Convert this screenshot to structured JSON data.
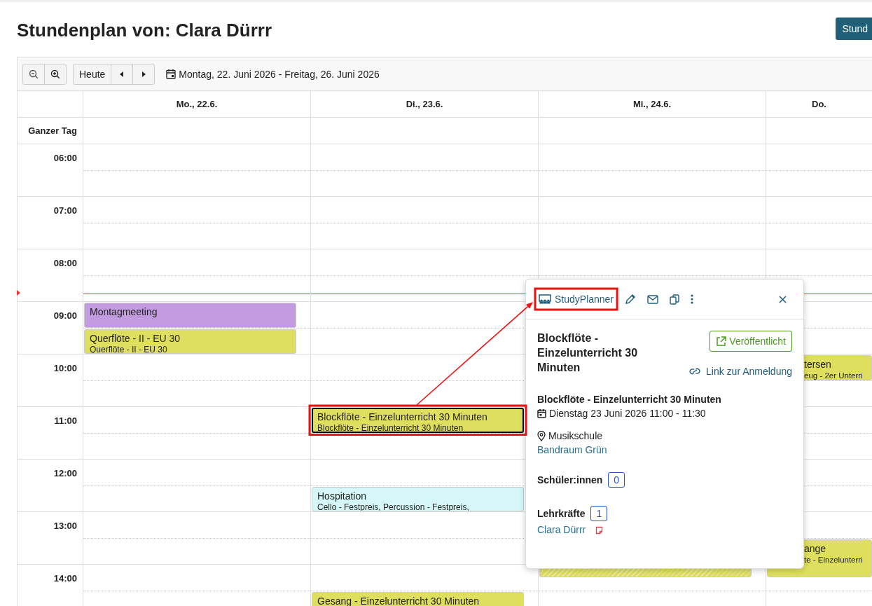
{
  "page": {
    "title": "Stundenplan von: Clara Dürrr",
    "action_button": "Stund"
  },
  "toolbar": {
    "today": "Heute",
    "date_range": "Montag, 22. Juni 2026 - Freitag, 26. Juni 2026"
  },
  "calendar": {
    "all_day_label": "Ganzer Tag",
    "days": [
      {
        "label": "Mo., 22.6."
      },
      {
        "label": "Di., 23.6."
      },
      {
        "label": "Mi., 24.6."
      },
      {
        "label": "Do."
      }
    ],
    "hours": [
      {
        "label": "06:00"
      },
      {
        "label": "07:00"
      },
      {
        "label": "08:00",
        "now_line": true
      },
      {
        "label": "09:00",
        "mo": [
          {
            "kind": "solid",
            "title": "Montagmeeting",
            "half": false,
            "long": false,
            "color": "#c39be0",
            "selected": false
          },
          {
            "kind": "solid",
            "title": "Querflöte - II - EU 30",
            "subtitle": "Querflöte - II - EU 30",
            "half": true,
            "long": false,
            "color": "#dfdf5f",
            "selected": false
          }
        ]
      },
      {
        "label": "10:00",
        "do": [
          {
            "kind": "solid",
            "title": "tersen",
            "subtitle": "eug - 2er Unterri",
            "half": false,
            "long": false,
            "color": "#dfdf5f",
            "selected": false
          }
        ]
      },
      {
        "label": "11:00",
        "di": [
          {
            "kind": "solid",
            "title": "Blockflöte - Einzelunterricht 30 Minuten",
            "subtitle": "Blockflöte - Einzelunterricht 30 Minuten",
            "half": false,
            "long": false,
            "color": "#dfdf5f",
            "selected": true
          }
        ]
      },
      {
        "label": "12:00",
        "di": [
          {
            "kind": "solid",
            "title": "Hospitation",
            "subtitle": "Cello - Festpreis, Percussion - Festpreis,",
            "half": true,
            "long": false,
            "color": "#d5f7f7",
            "selected": false
          }
        ]
      },
      {
        "label": "13:00",
        "mi": [
          {
            "kind": "striped",
            "half": true,
            "long": true,
            "color": "#dfdf5f",
            "selected": false
          }
        ],
        "do": [
          {
            "kind": "solid",
            "title": "ange",
            "subtitle": "te - Einzelunterri",
            "half": true,
            "long": true,
            "color": "#dfdf5f",
            "selected": false
          }
        ]
      },
      {
        "label": "14:00",
        "di": [
          {
            "kind": "solid",
            "title": "Gesang - Einzelunterricht 30 Minuten",
            "half": true,
            "color": "#dfdf5f",
            "selected": false
          }
        ]
      }
    ]
  },
  "popup": {
    "source": "StudyPlanner",
    "title": "Blockflöte - Einzelunterricht 30 Minuten",
    "status": "Veröffentlicht",
    "registration_link": "Link zur Anmeldung",
    "course": "Blockflöte - Einzelunterricht 30 Minuten",
    "date": "Dienstag 23 Juni 2026 11:00 - 11:30",
    "location": "Musikschule",
    "room": "Bandraum Grün",
    "students_label": "Schüler:innen",
    "students_count": "0",
    "teachers_label": "Lehrkräfte",
    "teachers_count": "1",
    "teachers": [
      "Clara Dürrr"
    ]
  }
}
